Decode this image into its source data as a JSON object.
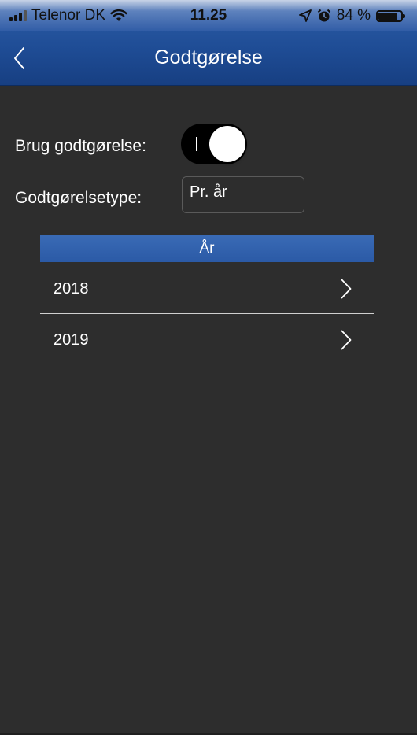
{
  "status_bar": {
    "carrier": "Telenor DK",
    "time": "11.25",
    "battery": "84 %",
    "battery_level": 0.84
  },
  "nav": {
    "title": "Godtgørelse",
    "back_icon": "chevron-left-icon"
  },
  "settings": {
    "use_label": "Brug godtgørelse:",
    "use_enabled": true,
    "type_label": "Godtgørelsetype:",
    "type_value": "Pr. år"
  },
  "year_list": {
    "header": "År",
    "items": [
      {
        "label": "2018"
      },
      {
        "label": "2019"
      }
    ]
  },
  "colors": {
    "background": "#2d2d2d",
    "accent": "#2b5aa6",
    "toggle_on": "#000000"
  }
}
